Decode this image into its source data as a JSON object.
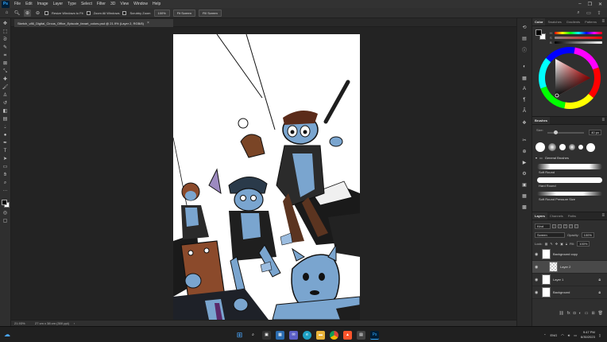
{
  "app": {
    "logo": "Ps",
    "menu": [
      "File",
      "Edit",
      "Image",
      "Layer",
      "Type",
      "Select",
      "Filter",
      "3D",
      "View",
      "Window",
      "Help"
    ],
    "window_controls": [
      "–",
      "❐",
      "✕"
    ]
  },
  "options_bar": {
    "resize_windows_label": "Resize Windows to Fit",
    "zoom_all_windows_label": "Zoom All Windows",
    "scrubby_zoom_label": "Scrubby Zoom",
    "zoom_100": "100%",
    "fit_screen": "Fit Screen",
    "fill_screen": "Fill Screen"
  },
  "document": {
    "tab_title": "Sketch_v86_Digital_Circus_Office_Episode_fanart_colors.psd @ 21.9% (Layer 2, RGB/8)",
    "close_glyph": "×"
  },
  "status": {
    "zoom": "21.93%",
    "doc_size": "27 cm x 38 cm (300 ppi)"
  },
  "color_panel": {
    "tabs": [
      "Color",
      "Swatches",
      "Gradients",
      "Patterns"
    ],
    "fg_color": "#000000",
    "bg_color": "#ffffff"
  },
  "brushes_panel": {
    "tabs": [
      "Brushes"
    ],
    "size_label": "Size:",
    "size_value": "40 px",
    "group_label": "General Brushes",
    "brushes": [
      "Soft Round",
      "Hard Round",
      "Soft Round Pressure Size"
    ]
  },
  "layers_panel": {
    "tabs": [
      "Layers",
      "Channels",
      "Paths"
    ],
    "kind": "Kind",
    "blend_mode": "Screen",
    "opacity_label": "Opacity:",
    "opacity_value": "100%",
    "lock_label": "Lock:",
    "fill_label": "Fill:",
    "fill_value": "100%",
    "layers": [
      {
        "name": "Background copy",
        "active": false
      },
      {
        "name": "Layer 2",
        "active": true
      },
      {
        "name": "Layer 1",
        "active": false
      },
      {
        "name": "Background",
        "active": false
      }
    ]
  },
  "taskbar": {
    "apps": [
      "windows",
      "search",
      "task-view",
      "widgets",
      "chat",
      "edge",
      "explorer",
      "chrome",
      "brave",
      "store",
      "photoshop"
    ],
    "language": "ENG",
    "time": "9:47 PM",
    "date": "6/30/2023"
  },
  "colors": {
    "accent": "#31a8ff",
    "character_blue": "#7aa5cf",
    "character_brown": "#8b4a2b"
  }
}
